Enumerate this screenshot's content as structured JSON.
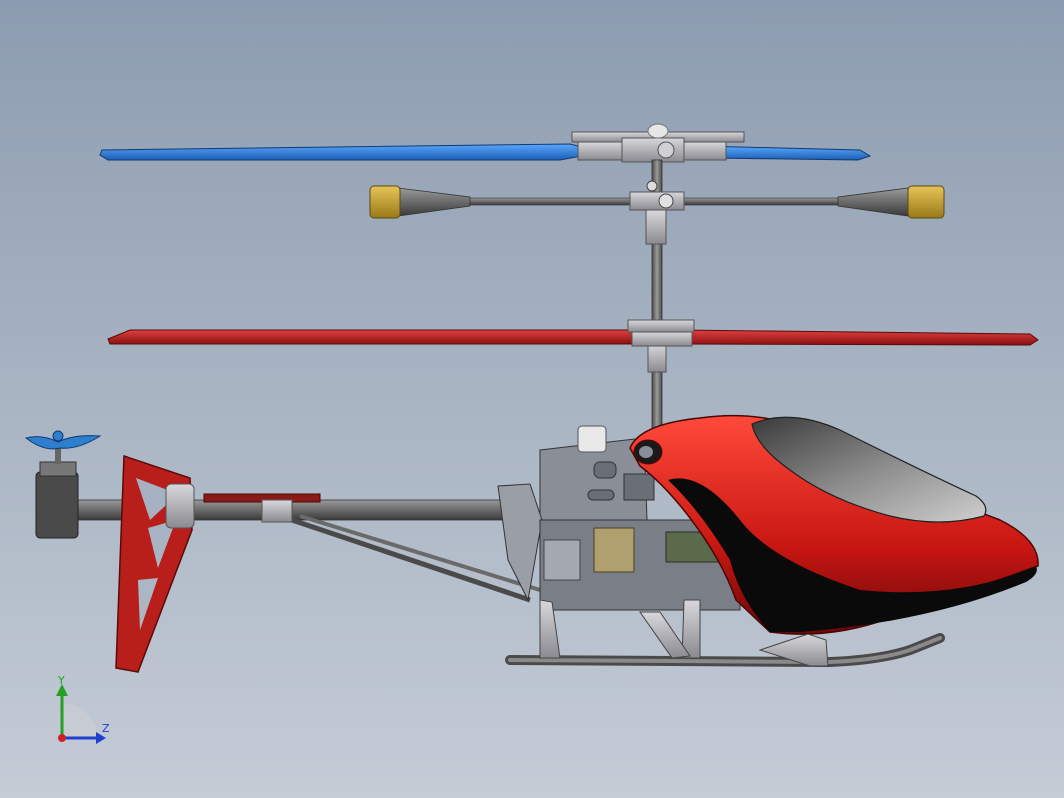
{
  "viewport": {
    "background_top": "#8c9cb0",
    "background_bottom": "#c4ccd6"
  },
  "model": {
    "upper_blade_color": "#2f86e6",
    "lower_blade_color": "#c0201e",
    "canopy_color": "#d01b18",
    "flybar_weight_color": "#c9a32a",
    "tail_fin_color": "#a01818",
    "tail_rotor_color": "#2f7fcf"
  },
  "triad": {
    "y_label": "Y",
    "z_label": "Z",
    "y_color": "#22a022",
    "z_color": "#1f3fd0",
    "x_color": "#d02020"
  }
}
